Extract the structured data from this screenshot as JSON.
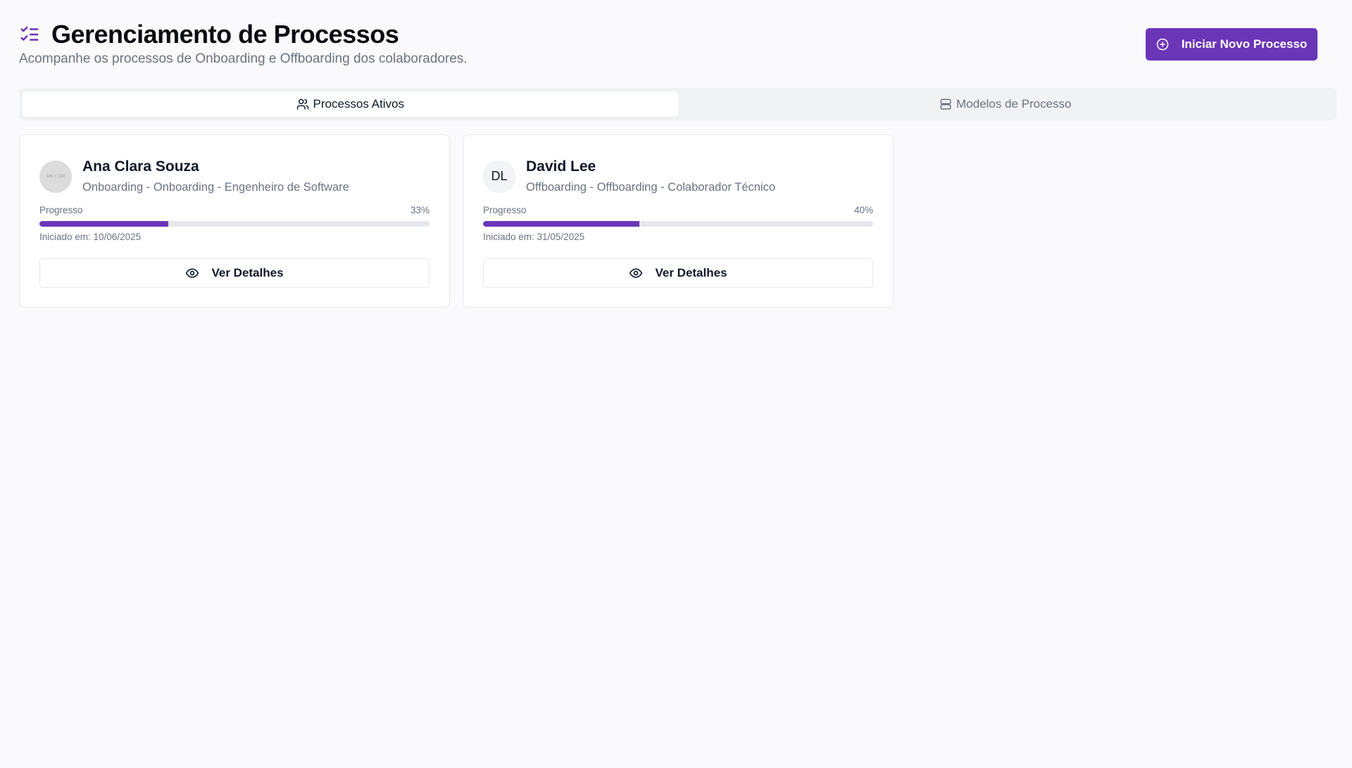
{
  "header": {
    "icon": "list-checks-icon",
    "title": "Gerenciamento de Processos",
    "subtitle": "Acompanhe os processos de Onboarding e Offboarding dos colaboradores.",
    "new_process_label": "Iniciar Novo Processo",
    "new_process_icon": "plus-circle-icon"
  },
  "tabs": [
    {
      "label": "Processos Ativos",
      "icon": "users-icon",
      "active": true
    },
    {
      "label": "Modelos de Processo",
      "icon": "server-icon",
      "active": false
    }
  ],
  "cards": [
    {
      "name": "Ana Clara Souza",
      "avatar_text": "100 × 100",
      "subtitle": "Onboarding - Onboarding - Engenheiro de Software",
      "progress_label": "Progresso",
      "progress_text": "33%",
      "progress": 33,
      "started": "Iniciado em: 10/06/2025",
      "details_label": "Ver Detalhes"
    },
    {
      "name": "David Lee",
      "avatar_text": "DL",
      "subtitle": "Offboarding - Offboarding - Colaborador Técnico",
      "progress_label": "Progresso",
      "progress_text": "40%",
      "progress": 40,
      "started": "Iniciado em: 31/05/2025",
      "details_label": "Ver Detalhes"
    }
  ],
  "colors": {
    "accent": "#6b35b8",
    "background": "#fafafc",
    "muted_text": "#6b7280"
  }
}
